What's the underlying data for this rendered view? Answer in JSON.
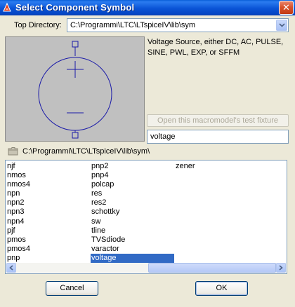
{
  "window": {
    "title": "Select Component Symbol",
    "close_glyph": "✕",
    "app_icon": "ltspice-icon",
    "title_color": "#0a54d6"
  },
  "top_directory": {
    "label": "Top Directory:",
    "value": "C:\\Programmi\\LTC\\LTspiceIV\\lib\\sym"
  },
  "preview": {
    "symbol": "voltage-source",
    "line_color": "#1a1aa8",
    "background": "#c0c0c0"
  },
  "description": "Voltage Source, either DC, AC, PULSE, SINE, PWL, EXP, or SFFM",
  "fixture_button": {
    "label": "Open this macromodel's test fixture",
    "enabled": false
  },
  "component_name": {
    "value": "voltage"
  },
  "current_path": "C:\\Programmi\\LTC\\LTspiceIV\\lib\\sym\\",
  "list": {
    "columns": [
      [
        "njf",
        "nmos",
        "nmos4",
        "npn",
        "npn2",
        "npn3",
        "npn4",
        "pjf",
        "pmos",
        "pmos4",
        "pnp"
      ],
      [
        "pnp2",
        "pnp4",
        "polcap",
        "res",
        "res2",
        "schottky",
        "sw",
        "tline",
        "TVSdiode",
        "varactor",
        "voltage"
      ],
      [
        "zener"
      ]
    ],
    "selected": "voltage",
    "selection_color": "#316ac5"
  },
  "buttons": {
    "cancel": "Cancel",
    "ok": "OK"
  }
}
